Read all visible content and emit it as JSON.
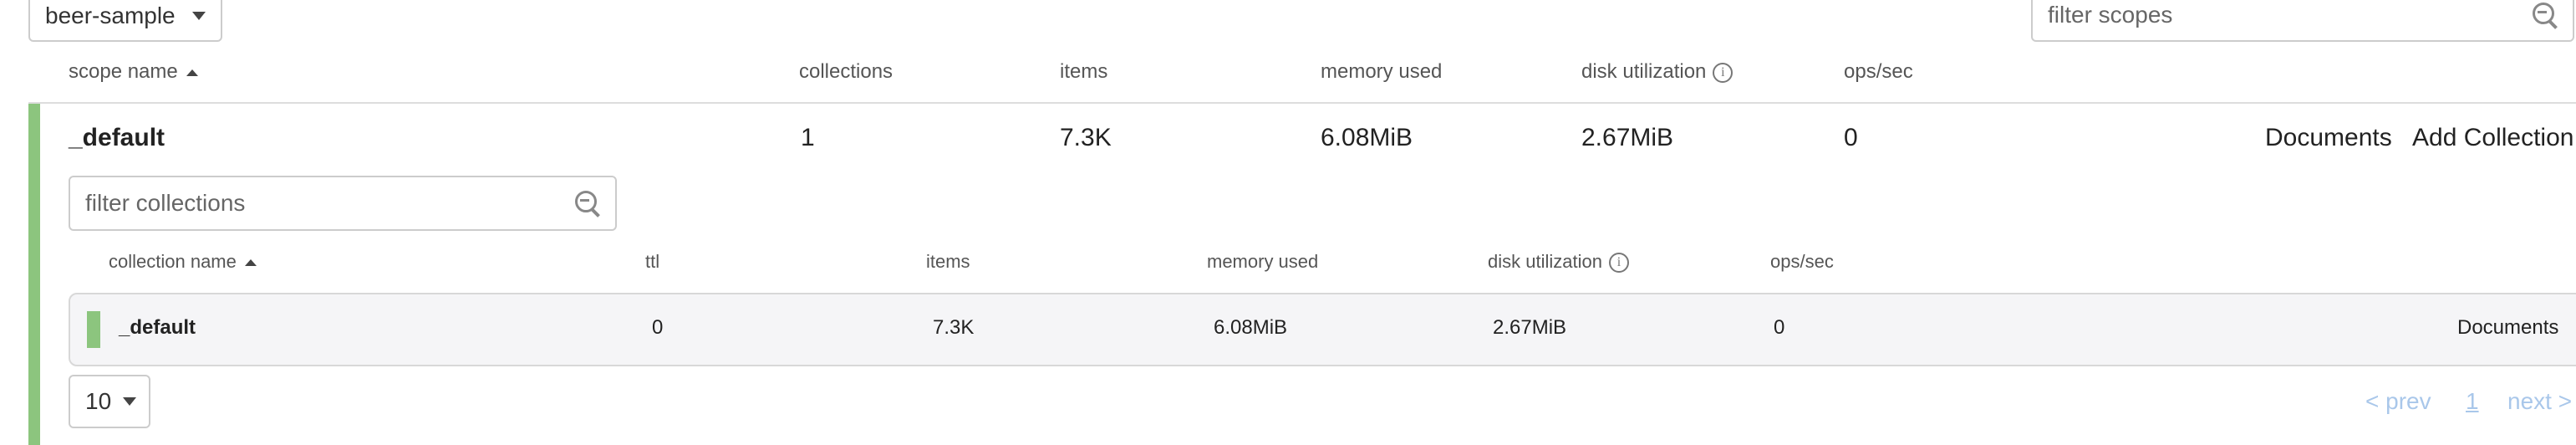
{
  "bucket_select": {
    "value": "beer-sample"
  },
  "scope_filter": {
    "placeholder": "filter scopes"
  },
  "scopes_table": {
    "headers": {
      "scope_name": "scope name",
      "collections": "collections",
      "items": "items",
      "memory_used": "memory used",
      "disk_utilization": "disk utilization",
      "ops_sec": "ops/sec"
    },
    "rows": [
      {
        "name": "_default",
        "collections": "1",
        "items": "7.3K",
        "memory_used": "6.08MiB",
        "disk_utilization": "2.67MiB",
        "ops_sec": "0",
        "documents_link": "Documents",
        "add_collection_link": "Add Collection"
      }
    ]
  },
  "collection_filter": {
    "placeholder": "filter collections"
  },
  "collections_table": {
    "headers": {
      "collection_name": "collection name",
      "ttl": "ttl",
      "items": "items",
      "memory_used": "memory used",
      "disk_utilization": "disk utilization",
      "ops_sec": "ops/sec"
    },
    "rows": [
      {
        "name": "_default",
        "ttl": "0",
        "items": "7.3K",
        "memory_used": "6.08MiB",
        "disk_utilization": "2.67MiB",
        "ops_sec": "0",
        "documents_link": "Documents"
      }
    ]
  },
  "pagination": {
    "page_size": "10",
    "prev": "< prev",
    "current": "1",
    "next": "next >"
  },
  "info_icon_glyph": "i",
  "colors": {
    "accent_green": "#8cc57e",
    "link_blue": "#4a8bd6",
    "disabled_blue": "#a9c7ea"
  }
}
